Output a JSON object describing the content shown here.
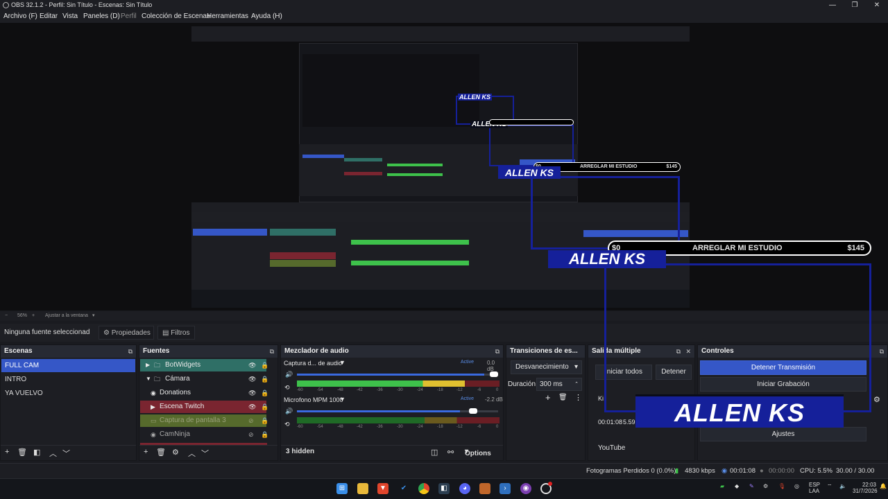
{
  "window": {
    "title": "OBS 32.1.2 - Perfil: Sin Título - Escenas: Sin Título"
  },
  "menu": [
    {
      "label": "Archivo (F)",
      "enabled": true
    },
    {
      "label": "Editar",
      "enabled": true
    },
    {
      "label": "Vista",
      "enabled": true
    },
    {
      "label": "Paneles (D)",
      "enabled": true
    },
    {
      "label": "Perfil",
      "enabled": false
    },
    {
      "label": "Colección de Escenas",
      "enabled": true
    },
    {
      "label": "Herramientas",
      "enabled": true
    },
    {
      "label": "Ayuda (H)",
      "enabled": true
    }
  ],
  "overlay": {
    "goal_label": "ARREGLAR MI ESTUDIO",
    "goal_current": "$0",
    "goal_target": "$145",
    "logo_text": "ALLEN KS",
    "accent": "#15209a"
  },
  "zoom": {
    "value": "56%",
    "fit": "Ajustar a la ventana"
  },
  "sourcebar": {
    "no_source": "Ninguna fuente seleccionad",
    "properties": "Propiedades",
    "filters": "Filtros"
  },
  "scenes": {
    "title": "Escenas",
    "items": [
      "FULL CAM",
      "INTRO",
      "YA VUELVO"
    ],
    "selected": 0
  },
  "sources": {
    "title": "Fuentes",
    "items": [
      {
        "name": "BotWidgets",
        "type": "group",
        "expanded": false,
        "color": "#2f6f66",
        "visible": true
      },
      {
        "name": "Cámara",
        "type": "group",
        "expanded": true,
        "color": "",
        "visible": true
      },
      {
        "name": "Donations",
        "type": "browser",
        "color": "",
        "visible": true
      },
      {
        "name": "Escena Twitch",
        "type": "scene",
        "color": "#7a2530",
        "visible": true
      },
      {
        "name": "Captura de pantalla 3",
        "type": "display",
        "color": "#566a2c",
        "visible": false
      },
      {
        "name": "CamNinja",
        "type": "browser",
        "color": "",
        "visible": false
      }
    ]
  },
  "mixer": {
    "title": "Mezclador de audio",
    "channels": [
      {
        "name": "Captura d... de audio",
        "status": "Active",
        "db": "0.0 dB",
        "volume": 0.93
      },
      {
        "name": "Microfono MPM 1000",
        "status": "Active",
        "db": "-2.2 dB",
        "volume": 0.81
      }
    ],
    "ticks": [
      "-60",
      "-54",
      "-48",
      "-42",
      "-36",
      "-30",
      "-24",
      "-18",
      "-12",
      "-6",
      "0"
    ],
    "hidden": "3 hidden",
    "options": "Options"
  },
  "transitions": {
    "title": "Transiciones de es...",
    "selected": "Desvanecimiento",
    "duration_label": "Duración",
    "duration": "300 ms"
  },
  "multistream": {
    "title": "Salida múltiple",
    "start_all": "Iniciar todos",
    "stop": "Detener",
    "ki": "Ki",
    "time": "00:01:08",
    "bitrate": "5.59",
    "service": "YouTube"
  },
  "controls": {
    "title": "Controles",
    "buttons": [
      "Detener Transmisión",
      "Iniciar Grabación",
      "Ajustes"
    ]
  },
  "status": {
    "frames": "Fotogramas Perdidos 0 (0.0%)",
    "kbps": "4830 kbps",
    "stream_time": "00:01:08",
    "rec_time": "00:00:00",
    "cpu": "CPU: 5.5%",
    "fps": "30.00 / 30.00 FPS"
  },
  "tray": {
    "lang1": "ESP",
    "lang2": "LAA",
    "time": "22:03",
    "date": "31/7/2026"
  }
}
